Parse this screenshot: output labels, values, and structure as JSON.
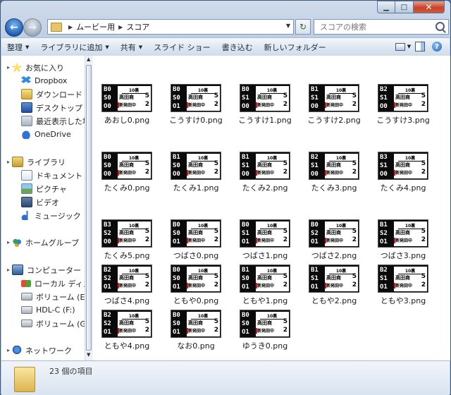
{
  "window": {
    "breadcrumb": [
      "ムービー用",
      "スコア"
    ],
    "search_placeholder": "スコアの検索"
  },
  "toolbar": {
    "items": [
      {
        "label": "整理",
        "dropdown": true
      },
      {
        "label": "ライブラリに追加",
        "dropdown": true
      },
      {
        "label": "共有",
        "dropdown": true
      },
      {
        "label": "スライド ショー",
        "dropdown": false
      },
      {
        "label": "書き込む",
        "dropdown": false
      },
      {
        "label": "新しいフォルダー",
        "dropdown": false
      }
    ]
  },
  "navpane": {
    "items": [
      {
        "label": "お気に入り",
        "icon": "favorites-star-icon",
        "level": 0
      },
      {
        "label": "Dropbox",
        "icon": "dropbox-icon",
        "level": 1
      },
      {
        "label": "ダウンロード",
        "icon": "downloads-folder-icon",
        "level": 1
      },
      {
        "label": "デスクトップ",
        "icon": "desktop-icon",
        "level": 1
      },
      {
        "label": "最近表示した場所",
        "icon": "recent-places-icon",
        "level": 1
      },
      {
        "label": "OneDrive",
        "icon": "onedrive-cloud-icon",
        "level": 1
      },
      {
        "label": "ライブラリ",
        "icon": "library-icon",
        "level": 0
      },
      {
        "label": "ドキュメント",
        "icon": "documents-icon",
        "level": 1
      },
      {
        "label": "ピクチャ",
        "icon": "pictures-icon",
        "level": 1
      },
      {
        "label": "ビデオ",
        "icon": "videos-icon",
        "level": 1
      },
      {
        "label": "ミュージック",
        "icon": "music-icon",
        "level": 1
      },
      {
        "label": "ホームグループ",
        "icon": "homegroup-icon",
        "level": 0
      },
      {
        "label": "コンピューター",
        "icon": "computer-icon",
        "level": 0
      },
      {
        "label": "ローカル ディスク",
        "icon": "local-disk-icon",
        "level": 1
      },
      {
        "label": "ボリューム (E:)",
        "icon": "drive-icon",
        "level": 1
      },
      {
        "label": "HDL-C (F:)",
        "icon": "drive-icon",
        "level": 1
      },
      {
        "label": "ボリューム (G:)",
        "icon": "drive-icon",
        "level": 1
      },
      {
        "label": "ネットワーク",
        "icon": "network-icon",
        "level": 0
      }
    ]
  },
  "files": [
    {
      "name": "あおし0.png",
      "b": "0",
      "s": "0",
      "o": "0"
    },
    {
      "name": "こうすけ0.png",
      "b": "0",
      "s": "0",
      "o": "1"
    },
    {
      "name": "こうすけ1.png",
      "b": "0",
      "s": "1",
      "o": "0"
    },
    {
      "name": "こうすけ2.png",
      "b": "1",
      "s": "1",
      "o": "0"
    },
    {
      "name": "こうすけ3.png",
      "b": "2",
      "s": "1",
      "o": "0"
    },
    {
      "name": "たくみ0.png",
      "b": "0",
      "s": "0",
      "o": "0"
    },
    {
      "name": "たくみ1.png",
      "b": "1",
      "s": "0",
      "o": "0"
    },
    {
      "name": "たくみ2.png",
      "b": "1",
      "s": "1",
      "o": "0"
    },
    {
      "name": "たくみ3.png",
      "b": "2",
      "s": "1",
      "o": "0"
    },
    {
      "name": "たくみ4.png",
      "b": "3",
      "s": "1",
      "o": "0"
    },
    {
      "name": "たくみ5.png",
      "b": "3",
      "s": "2",
      "o": "0"
    },
    {
      "name": "つばさ0.png",
      "b": "0",
      "s": "0",
      "o": "1"
    },
    {
      "name": "つばさ1.png",
      "b": "0",
      "s": "1",
      "o": "1"
    },
    {
      "name": "つばさ2.png",
      "b": "0",
      "s": "2",
      "o": "1"
    },
    {
      "name": "つばさ3.png",
      "b": "1",
      "s": "2",
      "o": "1"
    },
    {
      "name": "つばさ4.png",
      "b": "2",
      "s": "2",
      "o": "1"
    },
    {
      "name": "ともや0.png",
      "b": "0",
      "s": "0",
      "o": "1"
    },
    {
      "name": "ともや1.png",
      "b": "1",
      "s": "0",
      "o": "1"
    },
    {
      "name": "ともや2.png",
      "b": "1",
      "s": "1",
      "o": "1"
    },
    {
      "name": "ともや3.png",
      "b": "2",
      "s": "1",
      "o": "1"
    },
    {
      "name": "ともや4.png",
      "b": "2",
      "s": "2",
      "o": "1"
    },
    {
      "name": "なお0.png",
      "b": "0",
      "s": "0",
      "o": "1"
    },
    {
      "name": "ゆうき0.png",
      "b": "0",
      "s": "0",
      "o": "1"
    }
  ],
  "thumbnail": {
    "inning": "10裏",
    "team_top": "高田商",
    "team_bottom": "新発田中",
    "score_top": "5",
    "score_bottom": "2"
  },
  "details": {
    "item_count": "23 個の項目"
  }
}
